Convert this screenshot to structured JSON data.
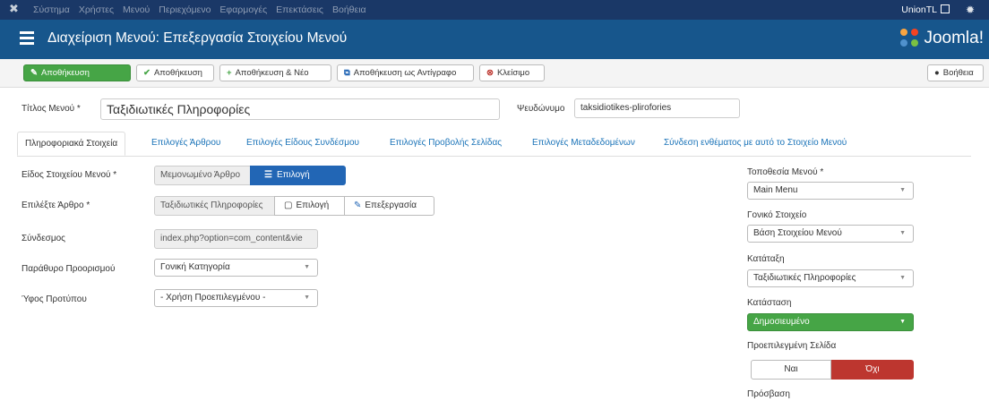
{
  "topnav": {
    "items": [
      "Σύστημα",
      "Χρήστες",
      "Μενού",
      "Περιεχόμενο",
      "Εφαρμογές",
      "Επεκτάσεις",
      "Βοήθεια"
    ],
    "site_name": "UnionTL"
  },
  "header": {
    "title": "Διαχείριση Μενού: Επεξεργασία Στοιχείου Μενού",
    "brand": "Joomla!"
  },
  "toolbar": {
    "save": "Αποθήκευση",
    "save_close": "Αποθήκευση",
    "save_new": "Αποθήκευση & Νέο",
    "save_copy": "Αποθήκευση ως Αντίγραφο",
    "close": "Κλείσιμο",
    "help": "Βοήθεια"
  },
  "form": {
    "title_label": "Τίτλος Μενού *",
    "title_value": "Ταξιδιωτικές Πληροφορίες",
    "alias_label": "Ψευδώνυμο",
    "alias_value": "taksidiotikes-plirofories"
  },
  "tabs": [
    "Πληροφοριακά Στοιχεία",
    "Επιλογές Άρθρου",
    "Επιλογές Είδους Συνδέσμου",
    "Επιλογές Προβολής Σελίδας",
    "Επιλογές Μεταδεδομένων",
    "Σύνδεση ενθέματος με αυτό το Στοιχείο Μενού"
  ],
  "details": {
    "type_label": "Είδος Στοιχείου Μενού *",
    "type_value": "Μεμονωμένο Άρθρο",
    "type_button": "Επιλογή",
    "article_label": "Επιλέξτε Άρθρο *",
    "article_value": "Ταξιδιωτικές Πληροφορίες",
    "article_select": "Επιλογή",
    "article_edit": "Επεξεργασία",
    "link_label": "Σύνδεσμος",
    "link_value": "index.php?option=com_content&vie",
    "target_label": "Παράθυρο Προορισμού",
    "target_value": "Γονική Κατηγορία",
    "style_label": "Ύφος Προτύπου",
    "style_value": "- Χρήση Προεπιλεγμένου -"
  },
  "sidebar": {
    "menu_label": "Τοποθεσία Μενού *",
    "menu_value": "Main Menu",
    "parent_label": "Γονικό Στοιχείο",
    "parent_value": "Βάση Στοιχείου Μενού",
    "order_label": "Κατάταξη",
    "order_value": "Ταξιδιωτικές Πληροφορίες",
    "status_label": "Κατάσταση",
    "status_value": "Δημοσιευμένο",
    "home_label": "Προεπιλεγμένη Σελίδα",
    "home_yes": "Ναι",
    "home_no": "Όχι",
    "access_label": "Πρόσβαση"
  },
  "colors": {
    "topnav": "#1a3867",
    "titlebar": "#17568c",
    "success": "#46a546",
    "danger": "#bd362f",
    "link": "#1a73b8",
    "primary_button": "#2266b5"
  }
}
